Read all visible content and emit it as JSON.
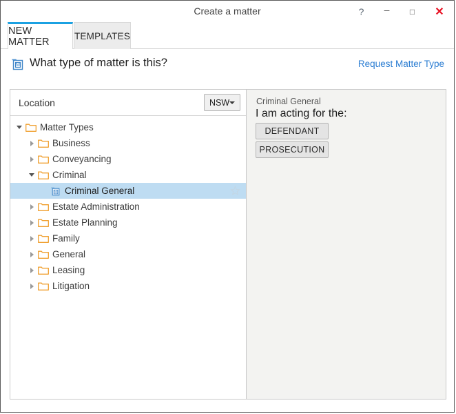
{
  "window": {
    "title": "Create a matter",
    "controls": [
      {
        "name": "help-button",
        "glyph": "?"
      },
      {
        "name": "minimize-button",
        "glyph": "–"
      },
      {
        "name": "maximize-button",
        "glyph": "□"
      },
      {
        "name": "close-button",
        "glyph": "✕"
      }
    ]
  },
  "tabs": [
    {
      "label": "NEW MATTER",
      "active": true
    },
    {
      "label": "TEMPLATES",
      "active": false
    }
  ],
  "header": {
    "icon": "matter-type-icon",
    "title": "What type of matter is this?",
    "link": "Request Matter Type"
  },
  "location": {
    "label": "Location",
    "selected": "NSW",
    "options": [
      "NSW"
    ]
  },
  "tree": [
    {
      "label": "Matter Types",
      "depth": 0,
      "state": "expanded",
      "icon": "folder-icon",
      "selected": false
    },
    {
      "label": "Business",
      "depth": 1,
      "state": "collapsed",
      "icon": "folder-icon",
      "selected": false
    },
    {
      "label": "Conveyancing",
      "depth": 1,
      "state": "collapsed",
      "icon": "folder-icon",
      "selected": false
    },
    {
      "label": "Criminal",
      "depth": 1,
      "state": "expanded",
      "icon": "folder-icon",
      "selected": false
    },
    {
      "label": "Criminal General",
      "depth": 2,
      "state": "leaf",
      "icon": "matter-type-icon",
      "selected": true
    },
    {
      "label": "Estate Administration",
      "depth": 1,
      "state": "collapsed",
      "icon": "folder-icon",
      "selected": false
    },
    {
      "label": "Estate Planning",
      "depth": 1,
      "state": "collapsed",
      "icon": "folder-icon",
      "selected": false
    },
    {
      "label": "Family",
      "depth": 1,
      "state": "collapsed",
      "icon": "folder-icon",
      "selected": false
    },
    {
      "label": "General",
      "depth": 1,
      "state": "collapsed",
      "icon": "folder-icon",
      "selected": false
    },
    {
      "label": "Leasing",
      "depth": 1,
      "state": "collapsed",
      "icon": "folder-icon",
      "selected": false
    },
    {
      "label": "Litigation",
      "depth": 1,
      "state": "collapsed",
      "icon": "folder-icon",
      "selected": false
    }
  ],
  "detail": {
    "matter_type": "Criminal General",
    "prompt": "I am acting for the:",
    "roles": [
      "DEFENDANT",
      "PROSECUTION"
    ]
  },
  "colors": {
    "accent": "#1ba1e2",
    "link": "#2b7dd2",
    "selection": "#bedcf2",
    "folder": "#f0a030",
    "close": "#e81123",
    "panel": "#f3f3f1"
  }
}
